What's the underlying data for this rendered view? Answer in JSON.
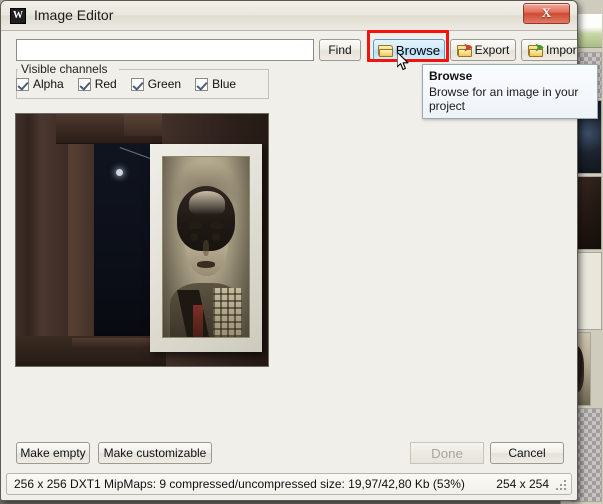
{
  "window": {
    "title": "Image Editor",
    "app_icon": "W",
    "close_label": "X",
    "close_icon": "close-icon"
  },
  "toolbar": {
    "search_value": "",
    "search_placeholder": "",
    "find_label": "Find",
    "browse_label": "Browse",
    "export_label": "Export",
    "import_label": "Import",
    "browse_icon": "folder-open-icon",
    "export_icon": "folder-export-icon",
    "import_icon": "folder-import-icon"
  },
  "tooltip": {
    "title": "Browse",
    "body": "Browse for an image in your project"
  },
  "channels": {
    "group_label": "Visible channels",
    "items": [
      {
        "label": "Alpha",
        "checked": true
      },
      {
        "label": "Red",
        "checked": true
      },
      {
        "label": "Green",
        "checked": true
      },
      {
        "label": "Blue",
        "checked": true
      }
    ]
  },
  "preview": {
    "description": "Dark wooden doorway interior with framed sepia portrait of a person"
  },
  "actions": {
    "make_empty_label": "Make empty",
    "make_customizable_label": "Make customizable",
    "done_label": "Done",
    "done_enabled": false,
    "cancel_label": "Cancel"
  },
  "statusbar": {
    "info": "256 x 256 DXT1 MipMaps: 9 compressed/uncompressed size: 19,97/42,80 Kb (53%)",
    "dimensions": "254 x 254"
  },
  "annotation": {
    "highlight_color": "#f5130f",
    "target": "browse-button"
  },
  "background": {
    "top_strip_text": "............  ........   ......  .......",
    "accent": "#8f8f86"
  }
}
